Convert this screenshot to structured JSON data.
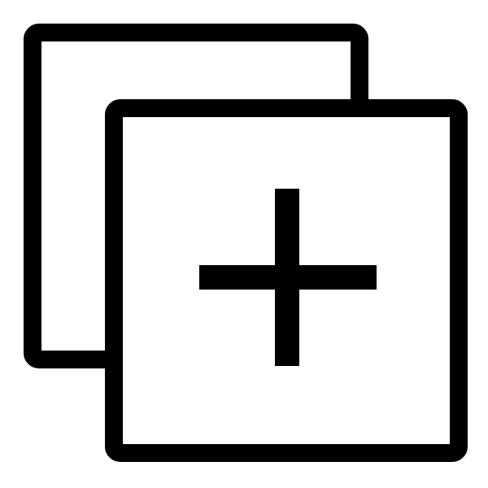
{
  "icon": {
    "name": "add-copy-icon",
    "description_name": "duplicate-add",
    "stroke_color": "#000000",
    "fill_color": "#ffffff",
    "background": "#ffffff"
  }
}
